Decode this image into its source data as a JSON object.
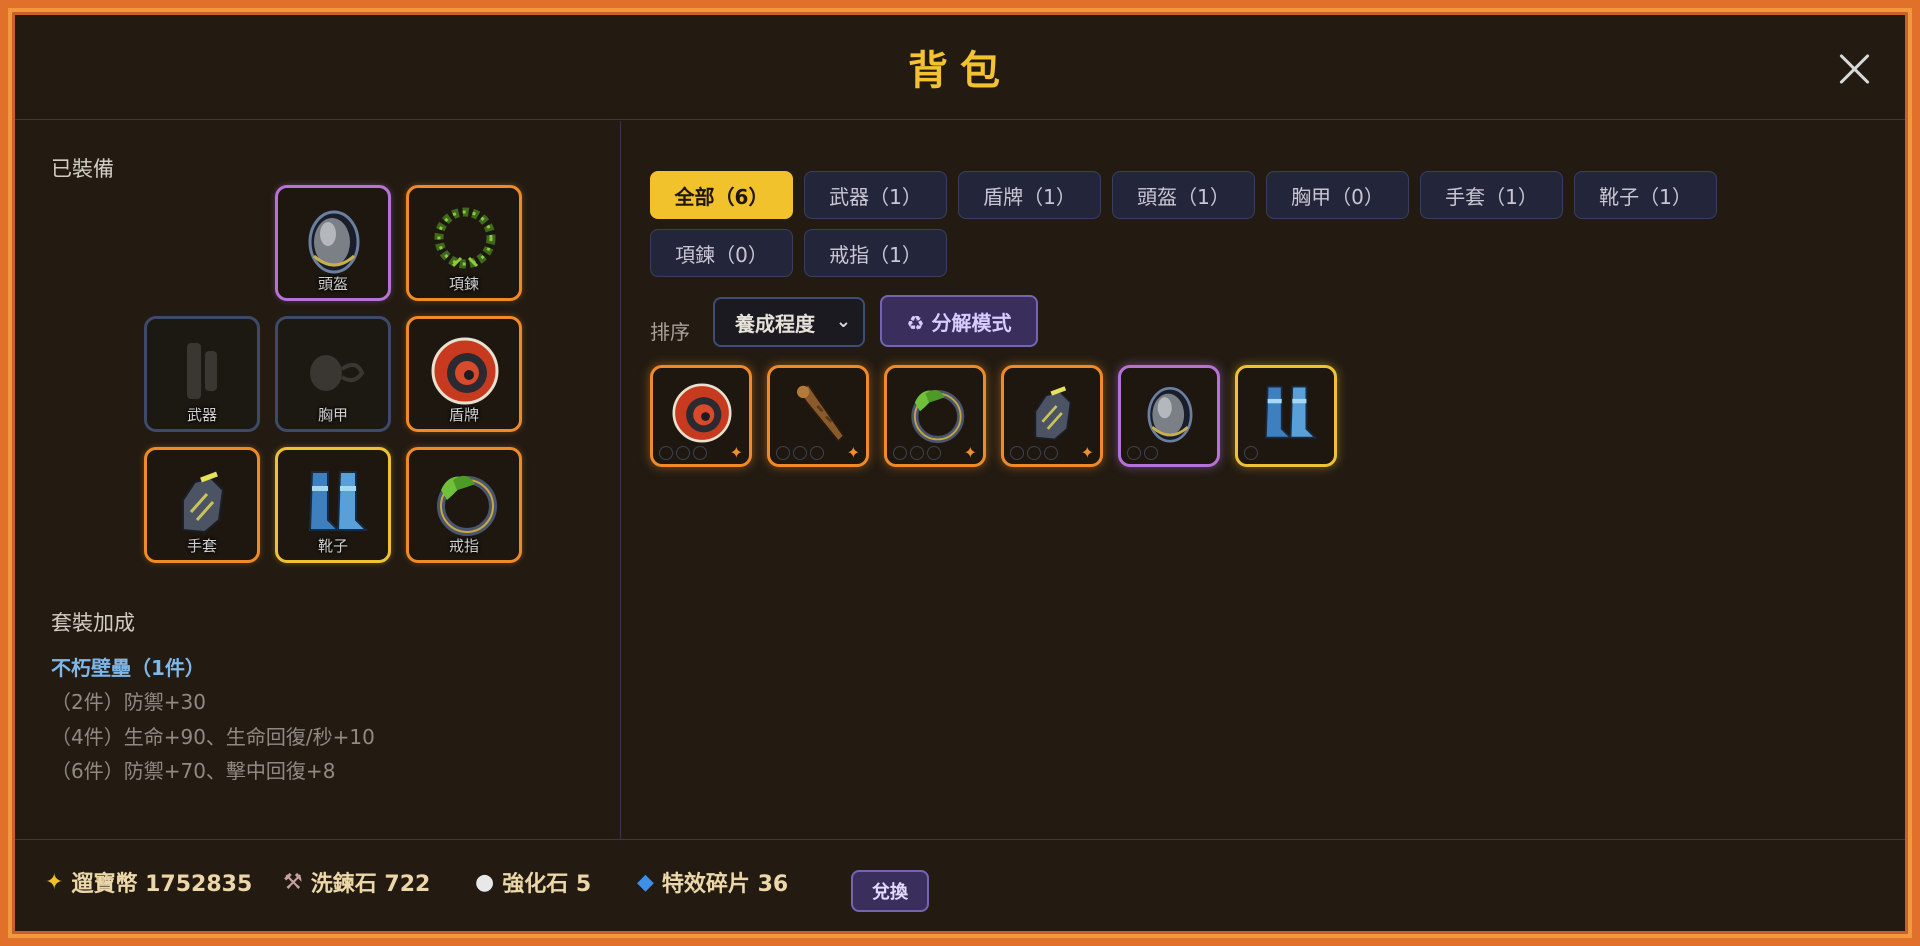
{
  "window": {
    "title": "背包"
  },
  "equipped": {
    "label": "已裝備",
    "slots": [
      {
        "name": "頭盔",
        "state": "equipped",
        "rarity": "purple",
        "icon": "helmet-icon"
      },
      {
        "name": "項鍊",
        "state": "equipped",
        "rarity": "orange",
        "icon": "necklace-icon"
      },
      {
        "name": "武器",
        "state": "empty",
        "rarity": "none",
        "icon": "weapon-icon"
      },
      {
        "name": "胸甲",
        "state": "empty",
        "rarity": "none",
        "icon": "chest-armor-icon"
      },
      {
        "name": "盾牌",
        "state": "equipped",
        "rarity": "orange",
        "icon": "shield-icon"
      },
      {
        "name": "手套",
        "state": "equipped",
        "rarity": "orange",
        "icon": "gloves-icon"
      },
      {
        "name": "靴子",
        "state": "equipped",
        "rarity": "gold",
        "icon": "boots-icon"
      },
      {
        "name": "戒指",
        "state": "equipped",
        "rarity": "orange",
        "icon": "ring-icon"
      }
    ]
  },
  "set_bonus": {
    "label": "套裝加成",
    "name": "不朽壁壘（1件）",
    "tiers": [
      "（2件）防禦+30",
      "（4件）生命+90、生命回復/秒+10",
      "（6件）防禦+70、擊中回復+8"
    ]
  },
  "filters": {
    "tabs": [
      {
        "label": "全部（6）",
        "active": true
      },
      {
        "label": "武器（1）",
        "active": false
      },
      {
        "label": "盾牌（1）",
        "active": false
      },
      {
        "label": "頭盔（1）",
        "active": false
      },
      {
        "label": "胸甲（0）",
        "active": false
      },
      {
        "label": "手套（1）",
        "active": false
      },
      {
        "label": "靴子（1）",
        "active": false
      },
      {
        "label": "項鍊（0）",
        "active": false
      },
      {
        "label": "戒指（1）",
        "active": false
      }
    ]
  },
  "sort": {
    "label": "排序",
    "selected": "養成程度"
  },
  "decompose": {
    "label": "♻ 分解模式"
  },
  "inventory": {
    "items": [
      {
        "kind": "shield",
        "rarity": "orange",
        "icon": "shield-icon",
        "sockets": 3,
        "special": true
      },
      {
        "kind": "weapon",
        "rarity": "orange",
        "icon": "club-icon",
        "sockets": 3,
        "special": true
      },
      {
        "kind": "ring",
        "rarity": "orange",
        "icon": "ring-icon",
        "sockets": 3,
        "special": true
      },
      {
        "kind": "gloves",
        "rarity": "orange",
        "icon": "gloves-icon",
        "sockets": 3,
        "special": true
      },
      {
        "kind": "helmet",
        "rarity": "purple",
        "icon": "helmet-icon",
        "sockets": 2,
        "special": false
      },
      {
        "kind": "boots",
        "rarity": "gold",
        "icon": "boots-icon",
        "sockets": 1,
        "special": false
      }
    ]
  },
  "currencies": {
    "coins": {
      "text": "遛寶幣 1752835",
      "icon": "sparkle-icon"
    },
    "reforge": {
      "text": "洗鍊石 722",
      "icon": "hammer-icon"
    },
    "enhance": {
      "text": "強化石 5",
      "icon": "stone-icon"
    },
    "shards": {
      "text": "特效碎片 36",
      "icon": "diamond-icon"
    }
  },
  "exchange": {
    "label": "兌換"
  },
  "colors": {
    "accent": "#f2c22c",
    "border_orange": "#f08a26",
    "border_purple": "#b772d8",
    "border_gold": "#efc233",
    "set_name": "#7fb7e8"
  }
}
